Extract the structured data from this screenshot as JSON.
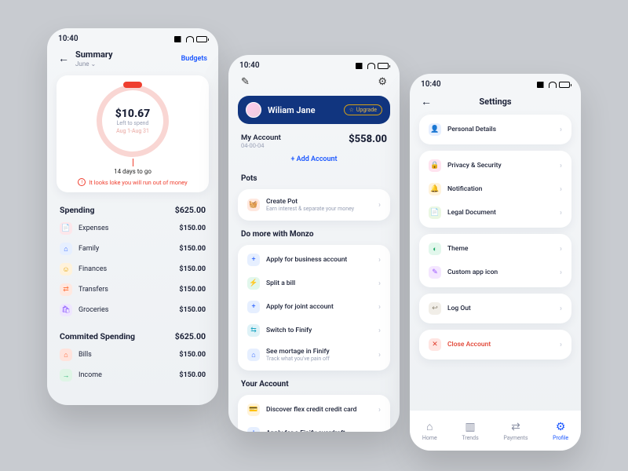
{
  "status": {
    "time": "10:40"
  },
  "screen1": {
    "title": "Summary",
    "subtitle": "June",
    "budgets": "Budgets",
    "amount": "$10.67",
    "subtitle2": "Left to spend",
    "dateRange": "Aug 1-Aug 31",
    "daysLeft": "14 days to go",
    "warning": "It looks loke you will run out of money",
    "spending": {
      "title": "Spending",
      "total": "$625.00"
    },
    "spendingItems": [
      {
        "icon": "📄",
        "bg": "#fde6ea",
        "fg": "#e14b7a",
        "label": "Expenses",
        "amount": "$150.00"
      },
      {
        "icon": "⌂",
        "bg": "#e6efff",
        "fg": "#3a6cff",
        "label": "Family",
        "amount": "$150.00"
      },
      {
        "icon": "☺",
        "bg": "#fff2da",
        "fg": "#e2a100",
        "label": "Finances",
        "amount": "$150.00"
      },
      {
        "icon": "⇄",
        "bg": "#ffe8e0",
        "fg": "#ff7a45",
        "label": "Transfers",
        "amount": "$150.00"
      },
      {
        "icon": "🛍",
        "bg": "#efe6ff",
        "fg": "#8a55ff",
        "label": "Groceries",
        "amount": "$150.00"
      }
    ],
    "committed": {
      "title": "Commited Spending",
      "total": "$625.00"
    },
    "committedItems": [
      {
        "icon": "⌂",
        "bg": "#ffe3dc",
        "fg": "#ff6a3d",
        "label": "Bills",
        "amount": "$150.00"
      },
      {
        "icon": "→",
        "bg": "#dff5e6",
        "fg": "#2bb673",
        "label": "Income",
        "amount": "$150.00"
      }
    ]
  },
  "screen2": {
    "profileName": "Wiliam Jane",
    "upgrade": "Upgrade",
    "account": {
      "label": "My Account",
      "number": "04-00-04",
      "balance": "$558.00"
    },
    "addAccount": "+  Add Account",
    "potsTitle": "Pots",
    "pots": [
      {
        "icon": "🧺",
        "bg": "#ffe8df",
        "fg": "#ff7a45",
        "title": "Create Pot",
        "sub": "Earn interest & separate your money"
      }
    ],
    "doMoreTitle": "Do more with Monzo",
    "doMore": [
      {
        "icon": "+",
        "bg": "#e6efff",
        "fg": "#1a56ff",
        "title": "Apply for business account"
      },
      {
        "icon": "⚡",
        "bg": "#e2f7ec",
        "fg": "#1aa864",
        "title": "Split a bill"
      },
      {
        "icon": "+",
        "bg": "#e6efff",
        "fg": "#1a56ff",
        "title": "Apply for joint account"
      },
      {
        "icon": "⇆",
        "bg": "#dff2f7",
        "fg": "#1ea7c4",
        "title": "Switch to Finify"
      },
      {
        "icon": "⌂",
        "bg": "#e6efff",
        "fg": "#3a6cff",
        "title": "See mortage in Finify",
        "sub": "Track what you've pain off"
      }
    ],
    "yourAccountTitle": "Your Account",
    "yourAccount": [
      {
        "icon": "💳",
        "bg": "#fff3da",
        "fg": "#e2a100",
        "title": "Discover flex credit credit card"
      },
      {
        "icon": "+",
        "bg": "#e6efff",
        "fg": "#1a56ff",
        "title": "Apply for a Finify overdraft"
      }
    ]
  },
  "screen3": {
    "title": "Settings",
    "group1": [
      {
        "icon": "👤",
        "bg": "#e6efff",
        "fg": "#3a6cff",
        "title": "Personal Details"
      }
    ],
    "group2": [
      {
        "icon": "🔒",
        "bg": "#ffe3ef",
        "fg": "#e14b7a",
        "title": "Privacy & Security"
      },
      {
        "icon": "🔔",
        "bg": "#fff2da",
        "fg": "#e2a100",
        "title": "Notification"
      },
      {
        "icon": "📄",
        "bg": "#eaf7e2",
        "fg": "#6cb53a",
        "title": "Legal Document"
      }
    ],
    "group3": [
      {
        "icon": "◐",
        "bg": "#e2f7ec",
        "fg": "#1aa864",
        "title": "Theme"
      },
      {
        "icon": "✎",
        "bg": "#f4e6ff",
        "fg": "#9a55ff",
        "title": "Custom app icon"
      }
    ],
    "group4": [
      {
        "icon": "↩",
        "bg": "#f1eee8",
        "fg": "#8a8270",
        "title": "Log Out"
      }
    ],
    "group5": [
      {
        "icon": "✕",
        "bg": "#ffe5e2",
        "fg": "#e03e2e",
        "title": "Close Account",
        "danger": true
      }
    ],
    "tabs": [
      {
        "icon": "⌂",
        "label": "Home"
      },
      {
        "icon": "▥",
        "label": "Trends"
      },
      {
        "icon": "⇄",
        "label": "Payments"
      },
      {
        "icon": "⚙",
        "label": "Profile",
        "active": true
      }
    ]
  }
}
